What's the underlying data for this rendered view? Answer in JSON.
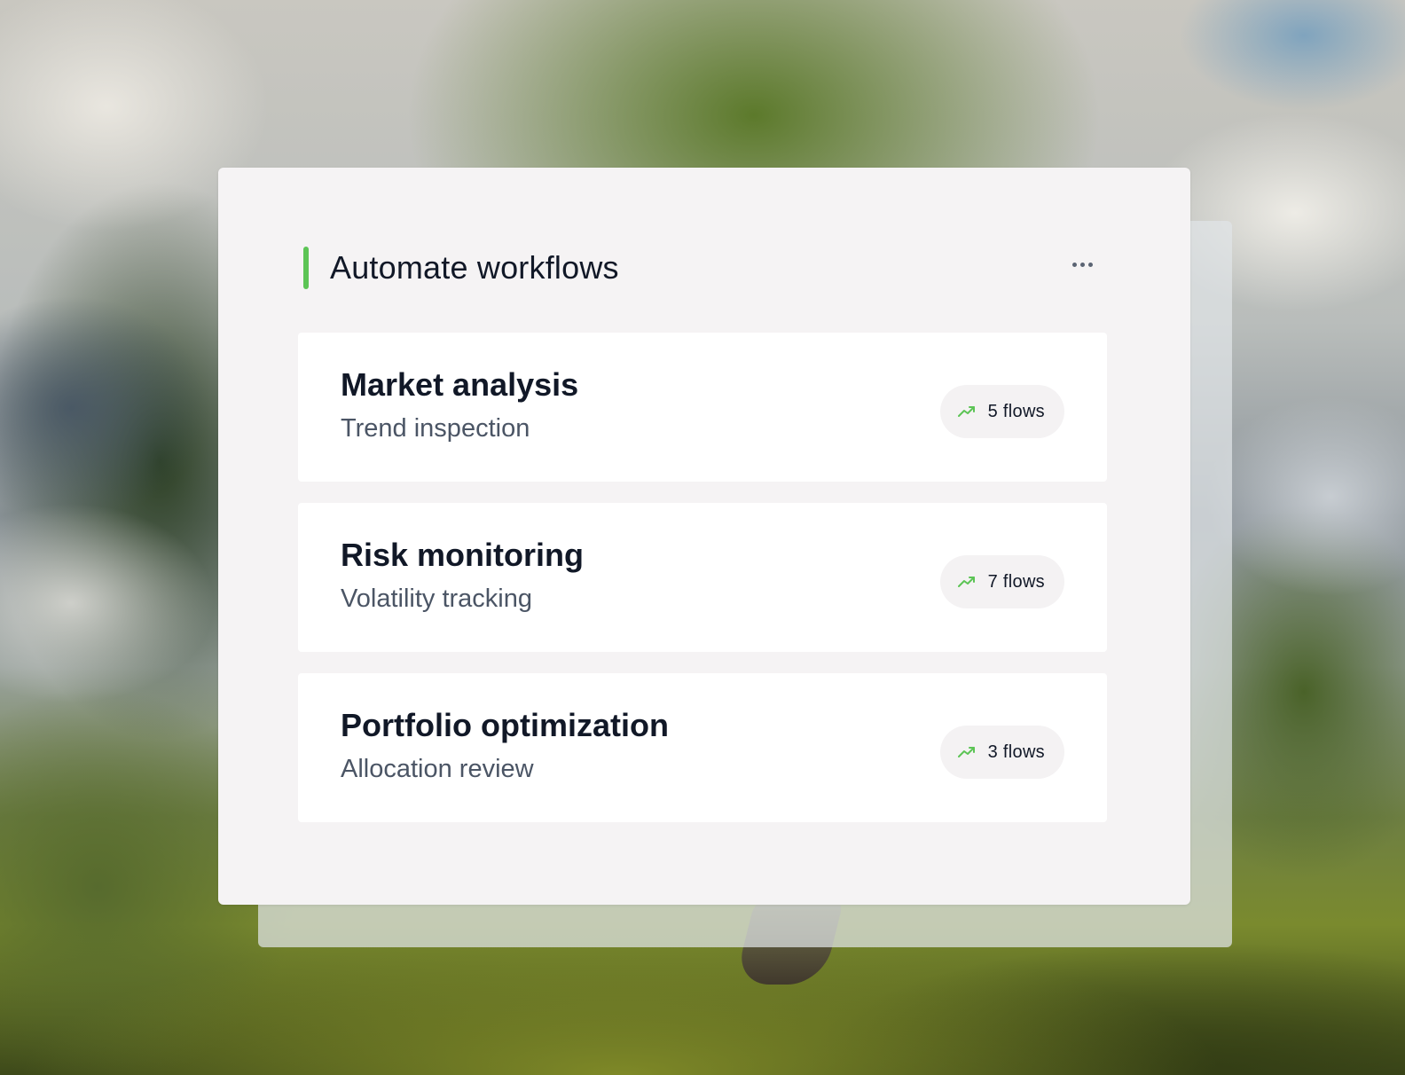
{
  "theme": {
    "accent_color": "#5cc455",
    "trend_icon_color": "#5cc455"
  },
  "card": {
    "title": "Automate workflows",
    "more_icon": "more-horizontal-icon"
  },
  "workflows": [
    {
      "title": "Market analysis",
      "subtitle": "Trend inspection",
      "badge": "5 flows",
      "icon": "trending-up-icon"
    },
    {
      "title": "Risk monitoring",
      "subtitle": "Volatility tracking",
      "badge": "7 flows",
      "icon": "trending-up-icon"
    },
    {
      "title": "Portfolio optimization",
      "subtitle": "Allocation review",
      "badge": "3 flows",
      "icon": "trending-up-icon"
    }
  ]
}
